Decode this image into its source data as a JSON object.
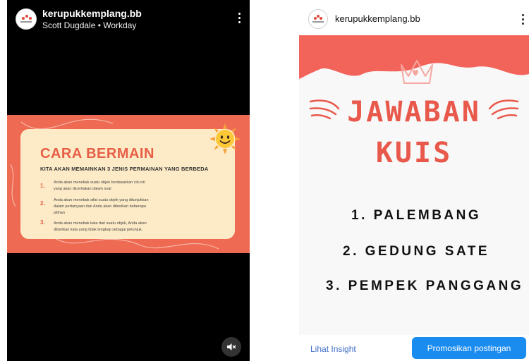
{
  "reel": {
    "username": "kerupukkemplang.bb",
    "subtitle": "Scott Dugdale • Workday",
    "slide": {
      "title": "CARA BERMAIN",
      "subtitle": "KITA AKAN MEMAINKAN 3 JENIS PERMAINAN YANG BERBEDA",
      "steps": [
        {
          "num": "1.",
          "text": "Anda akan menebak suatu objek berdasarkan ciri-ciri yang akan diceritakan dalam soal"
        },
        {
          "num": "2.",
          "text": "Anda akan menebak sifat suatu objek yang ditunjukkan dalam pertanyaan dan Anda akan diberikan beberapa pilihan"
        },
        {
          "num": "3.",
          "text": "Anda akan menebak kata dari suatu objek, Anda akan diberikan kata yang tidak lengkap sebagai petunjuk."
        }
      ]
    },
    "icons": {
      "more": "more-vertical-icon",
      "mute": "speaker-muted-icon",
      "sun": "smiling-sun-icon"
    }
  },
  "post": {
    "username": "kerupukkemplang.bb",
    "image": {
      "title_line1": "JAWABAN",
      "title_line2": "KUIS",
      "answers": [
        "1. PALEMBANG",
        "2. GEDUNG SATE",
        "3. PEMPEK PANGGANG"
      ]
    },
    "insight_link": "Lihat Insight",
    "promote_button": "Promosikan postingan"
  },
  "colors": {
    "slide_bg": "#ee6a52",
    "card_bg": "#fdebc7",
    "accent_red": "#e9594b",
    "button_blue": "#1a8cf0",
    "link_blue": "#3e6ec7"
  }
}
